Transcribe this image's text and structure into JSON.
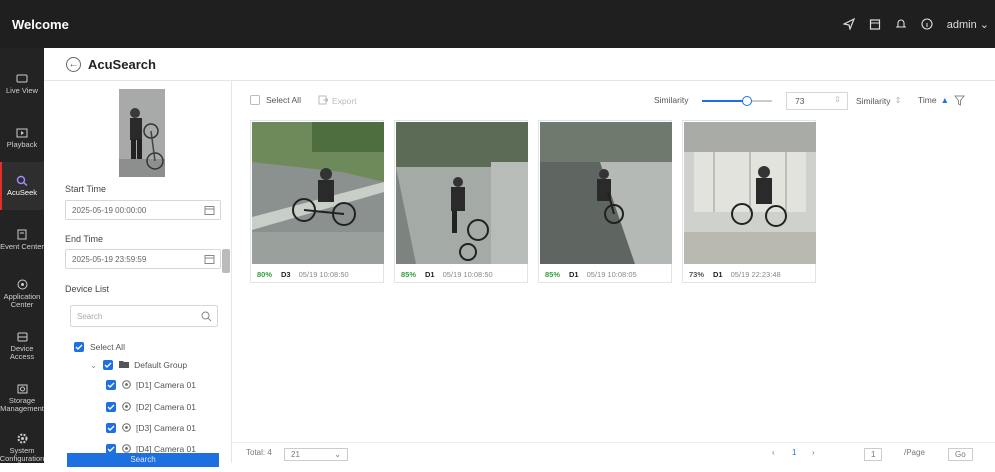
{
  "app": {
    "title": "Welcome",
    "user": "admin"
  },
  "nav": {
    "items": [
      {
        "label": "Live View",
        "icon": "monitor-icon"
      },
      {
        "label": "Playback",
        "icon": "playback-icon"
      },
      {
        "label": "AcuSeek",
        "icon": "acuseek-icon",
        "active": true
      },
      {
        "label": "Event Center",
        "icon": "event-center-icon"
      },
      {
        "label": "Application Center",
        "icon": "app-center-icon"
      },
      {
        "label": "Device Access",
        "icon": "device-access-icon"
      },
      {
        "label": "Storage Management",
        "icon": "storage-icon"
      },
      {
        "label": "System Configuration",
        "icon": "system-config-icon"
      }
    ]
  },
  "page": {
    "title": "AcuSearch"
  },
  "filters": {
    "start_label": "Start Time",
    "start_value": "2025-05-19 00:00:00",
    "end_label": "End Time",
    "end_value": "2025-05-19 23:59:59",
    "device_label": "Device List",
    "search_placeholder": "Search",
    "select_all": "Select All",
    "group": "Default Group",
    "cameras": [
      "[D1] Camera 01",
      "[D2] Camera 01",
      "[D3] Camera 01",
      "[D4] Camera 01"
    ],
    "search_button": "Search"
  },
  "toolbar": {
    "select_all": "Select All",
    "export": "Export",
    "similarity_label": "Similarity",
    "similarity_value": "73",
    "slider_level": 0.73,
    "sort_similarity": "Similarity",
    "sort_time": "Time"
  },
  "results": [
    {
      "similarity": "80%",
      "channel": "D3",
      "time": "05/19 10:08:50"
    },
    {
      "similarity": "85%",
      "channel": "D1",
      "time": "05/19 10:08:50"
    },
    {
      "similarity": "85%",
      "channel": "D1",
      "time": "05/19 10:08:05"
    },
    {
      "similarity": "73%",
      "channel": "D1",
      "time": "05/19 22:23:48"
    }
  ],
  "footer": {
    "total": "Total: 4",
    "page_size": "21",
    "page": "1",
    "page_input": "1",
    "per_page": "/Page",
    "go": "Go"
  },
  "colors": {
    "accent": "#1e6fe0",
    "high_similarity": "#30a03a",
    "nav_active": "#e0302b"
  }
}
